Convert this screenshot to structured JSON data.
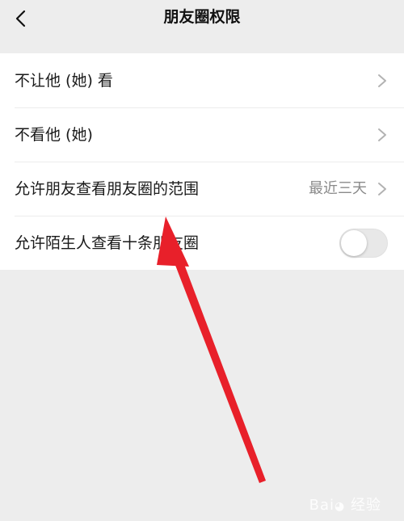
{
  "header": {
    "title": "朋友圈权限",
    "back_icon": "chevron-left-icon"
  },
  "settings": {
    "items": [
      {
        "label": "不让他 (她) 看",
        "icon": "chevron-right-icon"
      },
      {
        "label": "不看他 (她)",
        "icon": "chevron-right-icon"
      },
      {
        "label": "允许朋友查看朋友圈的范围",
        "value": "最近三天",
        "icon": "chevron-right-icon"
      },
      {
        "label": "允许陌生人查看十条朋友圈",
        "toggle": false
      }
    ]
  },
  "annotation": {
    "type": "arrow",
    "color": "#e8202a"
  },
  "colors": {
    "background": "#ededed",
    "list_background": "#ffffff",
    "value_text": "#8a8a8a",
    "toggle_off": "#e8e8e8"
  }
}
